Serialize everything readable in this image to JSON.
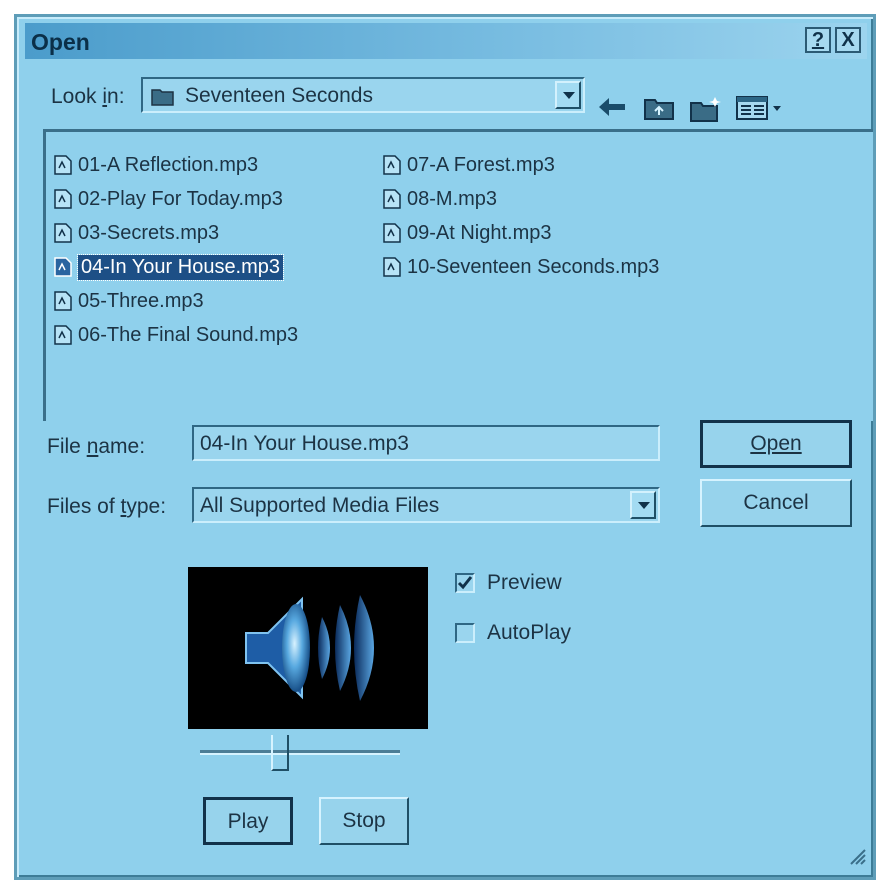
{
  "window": {
    "title": "Open",
    "help_label": "?",
    "close_label": "X"
  },
  "look_in": {
    "label": "Look in:",
    "value": "Seventeen Seconds"
  },
  "toolbar_icons": [
    "back-icon",
    "up-folder-icon",
    "new-folder-icon",
    "view-menu-icon"
  ],
  "files": [
    {
      "name": "01-A Reflection.mp3",
      "selected": false
    },
    {
      "name": "02-Play For Today.mp3",
      "selected": false
    },
    {
      "name": "03-Secrets.mp3",
      "selected": false
    },
    {
      "name": "04-In Your House.mp3",
      "selected": true
    },
    {
      "name": "05-Three.mp3",
      "selected": false
    },
    {
      "name": "06-The Final Sound.mp3",
      "selected": false
    },
    {
      "name": "07-A Forest.mp3",
      "selected": false
    },
    {
      "name": "08-M.mp3",
      "selected": false
    },
    {
      "name": "09-At Night.mp3",
      "selected": false
    },
    {
      "name": "10-Seventeen Seconds.mp3",
      "selected": false
    }
  ],
  "file_name": {
    "label": "File name:",
    "value": "04-In Your House.mp3"
  },
  "files_of_type": {
    "label": "Files of type:",
    "value": "All Supported Media Files"
  },
  "buttons": {
    "open": "Open",
    "cancel": "Cancel",
    "play": "Play",
    "stop": "Stop"
  },
  "preview": {
    "label": "Preview",
    "checked": true,
    "icon": "speaker-icon"
  },
  "autoplay": {
    "label": "AutoPlay",
    "checked": false
  },
  "slider": {
    "position": 0.43
  },
  "colors": {
    "dialog_bg": "#8fd0ec",
    "selection": "#1d4f86",
    "title_bar": "#4b9ccb"
  }
}
